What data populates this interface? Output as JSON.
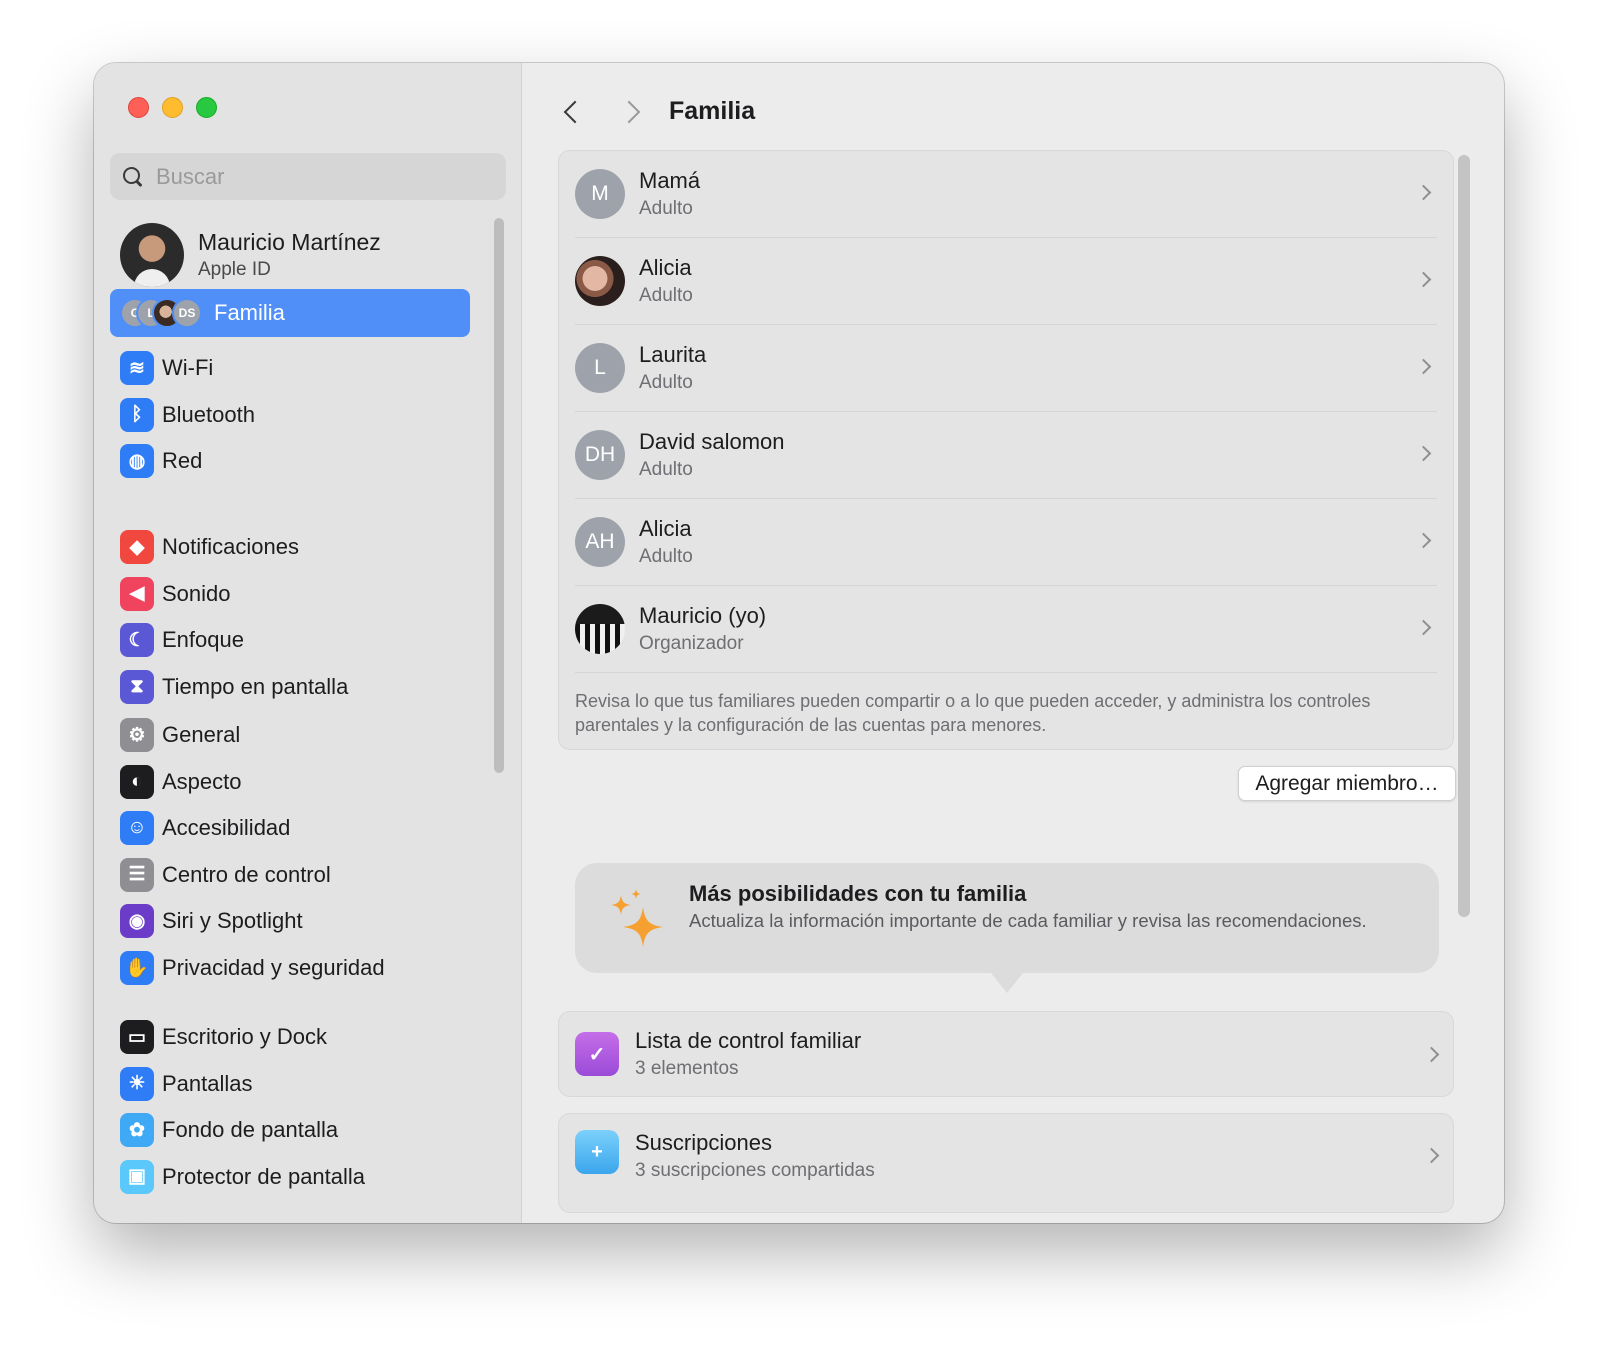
{
  "sidebar": {
    "search_placeholder": "Buscar",
    "account": {
      "name": "Mauricio Martínez",
      "sub": "Apple ID"
    },
    "family": {
      "label": "Familia",
      "avatars": [
        "C",
        "L",
        "",
        "DS"
      ]
    },
    "groups": [
      [
        {
          "label": "Wi-Fi",
          "icon": "wifi-icon",
          "color": "#2f7df6"
        },
        {
          "label": "Bluetooth",
          "icon": "bluetooth-icon",
          "color": "#2f7df6"
        },
        {
          "label": "Red",
          "icon": "globe-icon",
          "color": "#2f7df6"
        }
      ],
      [
        {
          "label": "Notificaciones",
          "icon": "bell-icon",
          "color": "#f0483e"
        },
        {
          "label": "Sonido",
          "icon": "speaker-icon",
          "color": "#f0445e"
        },
        {
          "label": "Enfoque",
          "icon": "moon-icon",
          "color": "#5b58d6"
        },
        {
          "label": "Tiempo en pantalla",
          "icon": "hourglass-icon",
          "color": "#5b58d6"
        }
      ],
      [
        {
          "label": "General",
          "icon": "gear-icon",
          "color": "#8e8e93"
        },
        {
          "label": "Aspecto",
          "icon": "appearance-icon",
          "color": "#1d1d1f"
        },
        {
          "label": "Accesibilidad",
          "icon": "accessibility-icon",
          "color": "#2f7df6"
        },
        {
          "label": "Centro de control",
          "icon": "toggles-icon",
          "color": "#8e8e93"
        },
        {
          "label": "Siri y Spotlight",
          "icon": "siri-icon",
          "color": "#6a3cc8"
        },
        {
          "label": "Privacidad y seguridad",
          "icon": "hand-icon",
          "color": "#2f7df6"
        }
      ],
      [
        {
          "label": "Escritorio y Dock",
          "icon": "dock-icon",
          "color": "#1d1d1f"
        },
        {
          "label": "Pantallas",
          "icon": "sun-icon",
          "color": "#2f7df6"
        },
        {
          "label": "Fondo de pantalla",
          "icon": "flower-icon",
          "color": "#3fa9f5"
        },
        {
          "label": "Protector de pantalla",
          "icon": "screensaver-icon",
          "color": "#5ac8fa"
        }
      ]
    ]
  },
  "main": {
    "title": "Familia",
    "members": [
      {
        "initials": "M",
        "name": "Mamá",
        "role": "Adulto"
      },
      {
        "initials": "",
        "name": "Alicia",
        "role": "Adulto",
        "photo": "alicia"
      },
      {
        "initials": "L",
        "name": "Laurita",
        "role": "Adulto"
      },
      {
        "initials": "DH",
        "name": "David salomon",
        "role": "Adulto"
      },
      {
        "initials": "AH",
        "name": "Alicia",
        "role": "Adulto"
      },
      {
        "initials": "",
        "name": "Mauricio (yo)",
        "role": "Organizador",
        "photo": "piano"
      }
    ],
    "members_note": "Revisa lo que tus familiares pueden compartir o a lo que pueden acceder, y administra los controles parentales y la configuración de las cuentas para menores.",
    "add_member_label": "Agregar miembro…",
    "promo": {
      "title": "Más posibilidades con tu familia",
      "subtitle": "Actualiza la información importante de cada familiar y revisa las recomendaciones."
    },
    "checklist": {
      "title": "Lista de control familiar",
      "subtitle": "3 elementos"
    },
    "subscriptions": {
      "title": "Suscripciones",
      "subtitle": "3 suscripciones compartidas"
    }
  }
}
